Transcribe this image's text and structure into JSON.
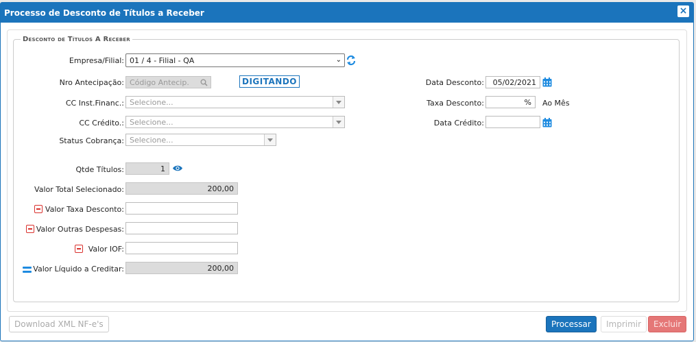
{
  "window": {
    "title": "Processo de Desconto de Títulos a Receber",
    "close_symbol": "×"
  },
  "group": {
    "legend": "Desconto de Títulos A Receber"
  },
  "left": {
    "empresa_label": "Empresa/Filial:",
    "empresa_value": "01 / 4 - Filial - QA",
    "empresa_chevron": "⌄",
    "nro_label": "Nro Antecipação:",
    "nro_placeholder": "Código Antecip.",
    "status_badge": "DIGITANDO",
    "cc_inst_label": "CC Inst.Financ.:",
    "cc_inst_placeholder": "Selecione...",
    "cc_credito_label": "CC Crédito.:",
    "cc_credito_placeholder": "Selecione...",
    "status_cobranca_label": "Status Cobrança:",
    "status_cobranca_placeholder": "Selecione...",
    "qtde_label": "Qtde Títulos:",
    "qtde_value": "1",
    "valor_total_label": "Valor Total Selecionado:",
    "valor_total_value": "200,00",
    "valor_taxa_label": "Valor Taxa Desconto:",
    "valor_taxa_value": "",
    "valor_outras_label": "Valor Outras Despesas:",
    "valor_outras_value": "",
    "valor_iof_label": "Valor IOF:",
    "valor_iof_value": "",
    "valor_liquido_label": "Valor Líquido a Creditar:",
    "valor_liquido_value": "200,00"
  },
  "right": {
    "data_desconto_label": "Data Desconto:",
    "data_desconto_value": "05/02/2021",
    "taxa_label": "Taxa Desconto:",
    "taxa_value": "%",
    "taxa_unit": "Ao Mês",
    "data_credito_label": "Data Crédito:",
    "data_credito_value": ""
  },
  "footer": {
    "download_label": "Download XML NF-e's",
    "processar_label": "Processar",
    "imprimir_label": "Imprimir",
    "excluir_label": "Excluir"
  },
  "colors": {
    "accent": "#1b74bc",
    "danger": "#e57777",
    "minus": "#d9302c"
  }
}
